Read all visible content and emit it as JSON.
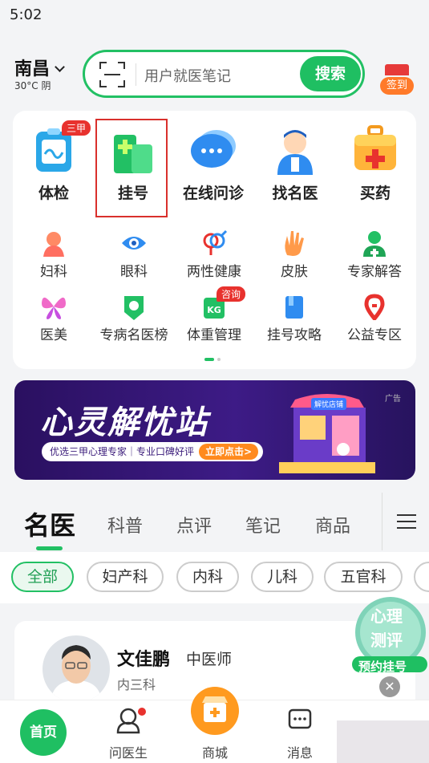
{
  "status": {
    "time": "5:02"
  },
  "header": {
    "city": "南昌",
    "weather": "30°C 阴",
    "search_placeholder": "用户就医笔记",
    "search_button": "搜索",
    "sign_label": "签到"
  },
  "services": [
    {
      "label": "体检",
      "badge": "三甲"
    },
    {
      "label": "挂号"
    },
    {
      "label": "在线问诊"
    },
    {
      "label": "找名医"
    },
    {
      "label": "买药"
    }
  ],
  "categories": [
    {
      "label": "妇科"
    },
    {
      "label": "眼科"
    },
    {
      "label": "两性健康"
    },
    {
      "label": "皮肤"
    },
    {
      "label": "专家解答"
    },
    {
      "label": "医美"
    },
    {
      "label": "专病名医榜"
    },
    {
      "label": "体重管理",
      "badge": "咨询"
    },
    {
      "label": "挂号攻略"
    },
    {
      "label": "公益专区"
    }
  ],
  "banner": {
    "title": "心灵解忧站",
    "subtitle": "优选三甲心理专家｜专业口碑好评",
    "cta": "立即点击>",
    "ad": "广告",
    "store_sign": "解忧店铺"
  },
  "tabs": [
    {
      "label": "名医"
    },
    {
      "label": "科普"
    },
    {
      "label": "点评"
    },
    {
      "label": "笔记"
    },
    {
      "label": "商品"
    }
  ],
  "chips": [
    {
      "label": "全部"
    },
    {
      "label": "妇产科"
    },
    {
      "label": "内科"
    },
    {
      "label": "儿科"
    },
    {
      "label": "五官科"
    }
  ],
  "doctor": {
    "name": "文佳鹏",
    "title": "中医师",
    "dept": "内三科"
  },
  "floating": {
    "line1": "心理",
    "line2": "测评",
    "cta": "预约挂号"
  },
  "nav": {
    "home": "首页",
    "ask": "问医生",
    "mall": "商城",
    "msg": "消息"
  },
  "colors": {
    "brand_green": "#1fbf62",
    "badge_red": "#e8322e"
  }
}
